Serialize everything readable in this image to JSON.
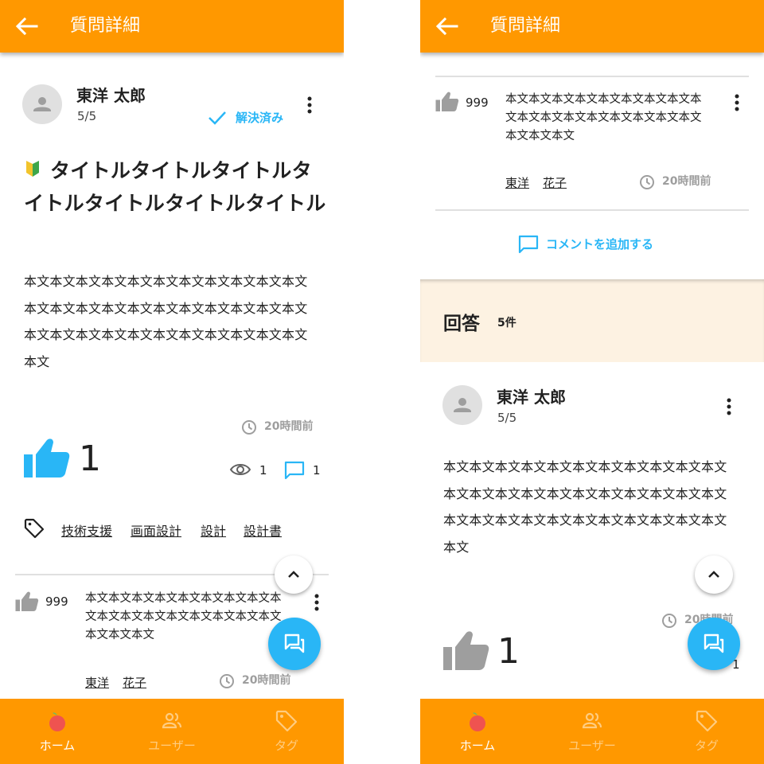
{
  "header": {
    "title": "質問詳細"
  },
  "question": {
    "author_name": "東洋 太郎",
    "author_score": "5/5",
    "resolved_label": "解決済み",
    "title": "タイトルタイトルタイトルタイトルタイトルタイトルタイトル",
    "body": "本文本文本文本文本文本文本文本文本文本文本文本文本文本文本文本文本文本文本文本文本文本文本文本文本文本文本文本文本文本文本文本文本文本文",
    "time": "20時間前",
    "like_count": "1",
    "view_count": "1",
    "comment_count": "1",
    "tags": [
      "技術支援",
      "画面設計",
      "設計",
      "設計書"
    ]
  },
  "comment": {
    "like_count": "999",
    "body": "本文本文本文本文本文本文本文本文本文本文本文本文本文本文本文本文本文本文本文本文",
    "users": [
      "東洋",
      "花子"
    ],
    "time": "20時間前"
  },
  "add_comment_label": "コメントを追加する",
  "answers": {
    "title": "回答",
    "count": "5件",
    "first": {
      "author_name": "東洋 太郎",
      "author_score": "5/5",
      "body": "本文本文本文本文本文本文本文本文本文本文本文本文本文本文本文本文本文本文本文本文本文本文本文本文本文本文本文本文本文本文本文本文本文本文",
      "time": "20時間前",
      "like_count": "1",
      "comment_count": "1"
    }
  },
  "nav": {
    "items": [
      {
        "label": "ホーム",
        "icon": "home-fruit-icon",
        "active": true
      },
      {
        "label": "ユーザー",
        "icon": "users-icon",
        "active": false
      },
      {
        "label": "タグ",
        "icon": "tag-icon",
        "active": false
      }
    ]
  },
  "colors": {
    "brand": "#ff9800",
    "accent": "#29b6f6",
    "answers_band": "#fdf2e2",
    "nav_inactive": "#ffcc80"
  }
}
